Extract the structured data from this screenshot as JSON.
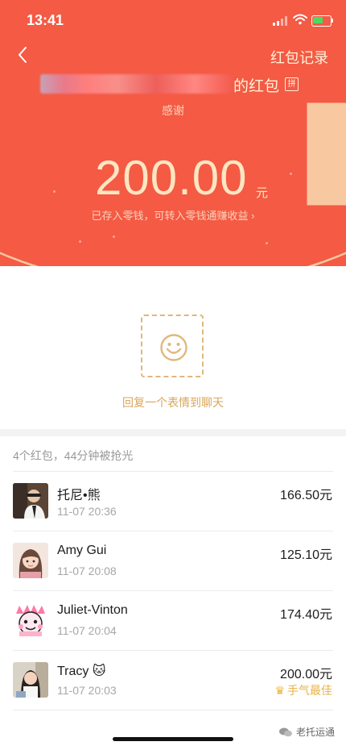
{
  "status_bar": {
    "time": "13:41"
  },
  "nav": {
    "record_label": "红包记录"
  },
  "packet": {
    "sender_suffix": "的红包",
    "pin_badge": "拼",
    "greeting": "感谢",
    "amount": "200.00",
    "unit": "元",
    "deposit_note": "已存入零钱，可转入零钱通赚收益 ›"
  },
  "reply": {
    "label": "回复一个表情到聊天"
  },
  "summary": "4个红包，44分钟被抢光",
  "records": [
    {
      "name": "托尼•熊",
      "time": "11-07 20:36",
      "amount": "166.50元"
    },
    {
      "name": "Amy Gui",
      "time": "11-07 20:08",
      "amount": "125.10元"
    },
    {
      "name": "Juliet-Vinton",
      "time": "11-07 20:04",
      "amount": "174.40元"
    },
    {
      "name": "Tracy 🐱",
      "time": "11-07 20:03",
      "amount": "200.00元",
      "badge": "手气最佳"
    }
  ],
  "watermark": "老托运通",
  "colors": {
    "header_red": "#f45a44",
    "gold": "#d8a657",
    "amount_cream": "#fde6c2"
  },
  "icons": {
    "back": "chevron-left-icon",
    "reply": "smiley-face-icon",
    "best": "crown-icon"
  }
}
